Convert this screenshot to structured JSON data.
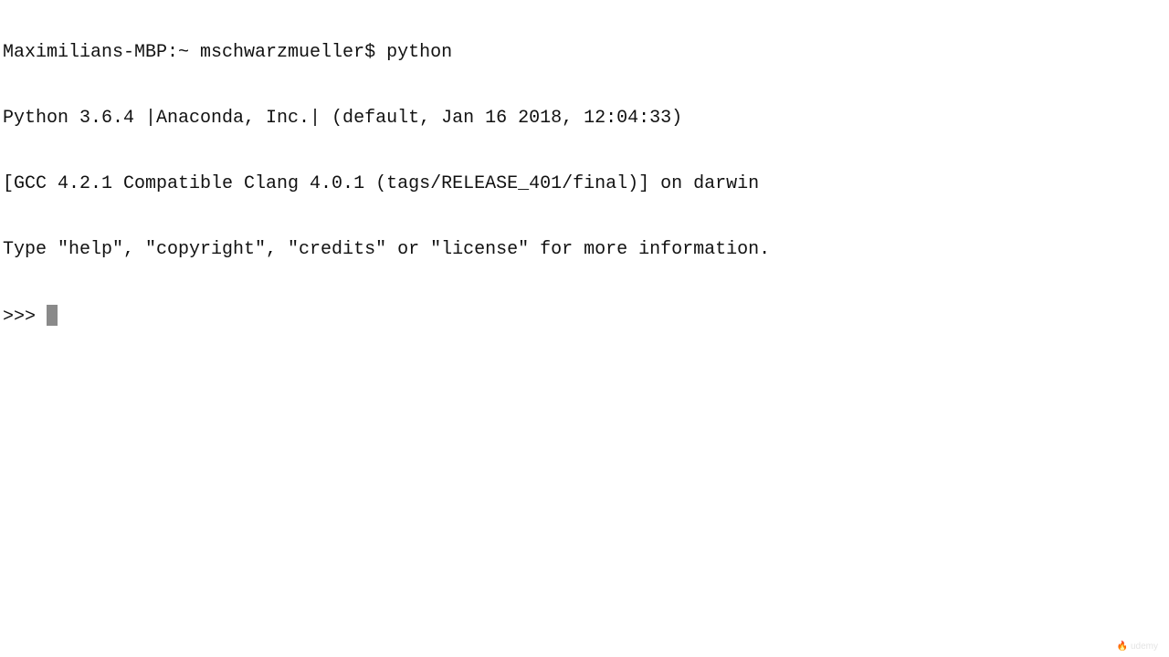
{
  "terminal": {
    "lines": [
      "Maximilians-MBP:~ mschwarzmueller$ python",
      "Python 3.6.4 |Anaconda, Inc.| (default, Jan 16 2018, 12:04:33)",
      "[GCC 4.2.1 Compatible Clang 4.0.1 (tags/RELEASE_401/final)] on darwin",
      "Type \"help\", \"copyright\", \"credits\" or \"license\" for more information."
    ],
    "prompt": ">>> "
  },
  "watermark": {
    "text": "udemy",
    "icon": "udemy-logo-icon"
  }
}
